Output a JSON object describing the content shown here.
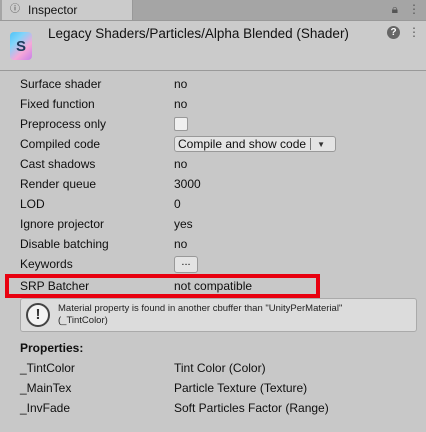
{
  "tab": {
    "label": "Inspector",
    "icon": "info-icon"
  },
  "header": {
    "title": "Legacy Shaders/Particles/Alpha Blended (Shader)"
  },
  "rows": [
    {
      "label": "Surface shader",
      "value": "no"
    },
    {
      "label": "Fixed function",
      "value": "no"
    },
    {
      "label": "Preprocess only",
      "checked": false
    },
    {
      "label": "Compiled code",
      "value": "Compile and show code"
    },
    {
      "label": "Cast shadows",
      "value": "no"
    },
    {
      "label": "Render queue",
      "value": "3000"
    },
    {
      "label": "LOD",
      "value": "0"
    },
    {
      "label": "Ignore projector",
      "value": "yes"
    },
    {
      "label": "Disable batching",
      "value": "no"
    },
    {
      "label": "Keywords",
      "button": "..."
    },
    {
      "label": "SRP Batcher",
      "value": "not compatible"
    }
  ],
  "help": {
    "line1": "Material property is found in another cbuffer than \"UnityPerMaterial\"",
    "line2": "(_TintColor)"
  },
  "properties": {
    "heading": "Properties:",
    "items": [
      {
        "name": "_TintColor",
        "desc": "Tint Color (Color)"
      },
      {
        "name": "_MainTex",
        "desc": "Particle Texture (Texture)"
      },
      {
        "name": "_InvFade",
        "desc": "Soft Particles Factor (Range)"
      }
    ]
  },
  "colors": {
    "highlight": "#e8000f",
    "background": "#c8c8c8"
  }
}
